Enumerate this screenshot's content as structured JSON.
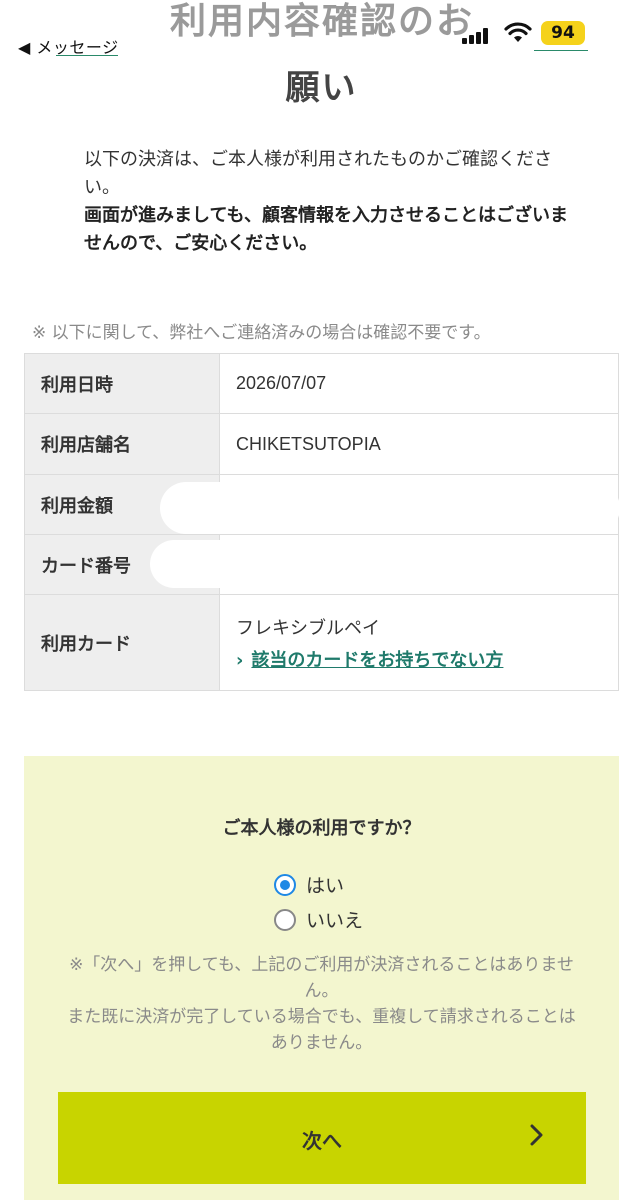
{
  "status_bar": {
    "back_label": "◀ メッセージ",
    "battery": "94",
    "battery_color": "#f5d21b"
  },
  "header": {
    "title_partial": "利用内容確認のお",
    "title_line2": "願い"
  },
  "intro": {
    "line1": "以下の決済は、ご本人様が利用されたものかご確認ください。",
    "line2": "画面が進みましても、顧客情報を入力させることはございませんので、ご安心ください。"
  },
  "notice": "※ 以下に関して、弊社へご連絡済みの場合は確認不要です。",
  "table": {
    "rows": [
      {
        "label": "利用日時",
        "value": "2026/07/07"
      },
      {
        "label": "利用店舗名",
        "value": "CHIKETSUTOPIA"
      },
      {
        "label": "利用金額",
        "value": ""
      },
      {
        "label": "カード番号",
        "value": ""
      },
      {
        "label": "利用カード",
        "value": "フレキシブルペイ",
        "link": "該当のカードをお持ちでない方"
      }
    ]
  },
  "confirm": {
    "question": "ご本人様の利用ですか？",
    "options": [
      {
        "label": "はい",
        "selected": true
      },
      {
        "label": "いいえ",
        "selected": false
      }
    ],
    "note_line1": "※「次へ」を押しても、上記のご利用が決済されることはありません。",
    "note_line2": "また既に決済が完了している場合でも、重複して請求されることはありません。",
    "next_label": "次へ",
    "background": "#f3f6cf",
    "button_color": "#c8d400",
    "link_color": "#1f7a6b",
    "radio_color": "#1e88e5"
  }
}
